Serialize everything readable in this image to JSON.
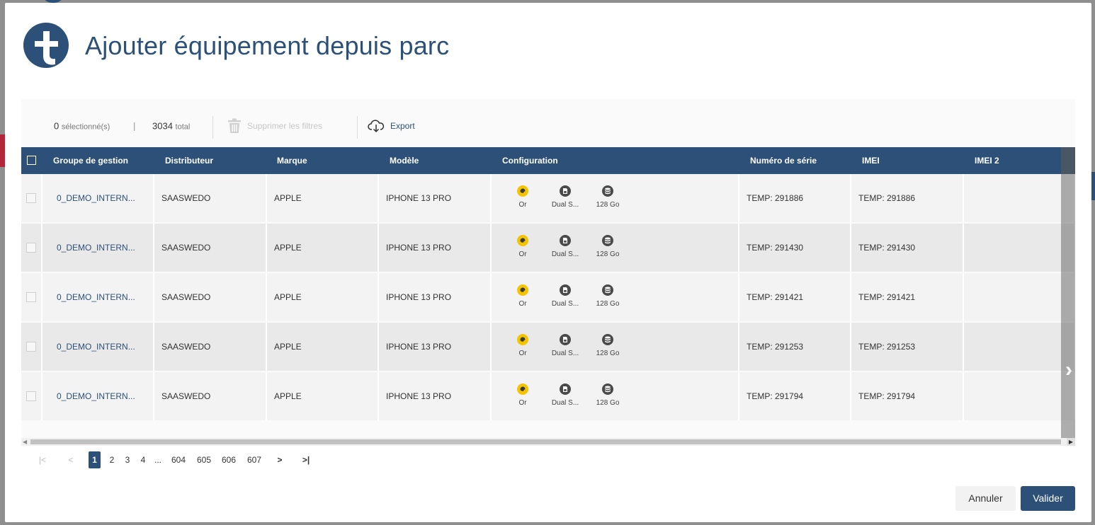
{
  "dialog": {
    "title": "Ajouter équipement depuis parc"
  },
  "toolbar": {
    "selected_count": "0",
    "selected_label": "sélectionné(s)",
    "separator": "|",
    "total_count": "3034",
    "total_label": "total",
    "clear_filters_label": "Supprimer les filtres",
    "export_label": "Export"
  },
  "table": {
    "headers": {
      "group": "Groupe de gestion",
      "distributor": "Distributeur",
      "brand": "Marque",
      "model": "Modèle",
      "configuration": "Configuration",
      "serial": "Numéro de série",
      "imei": "IMEI",
      "imei2": "IMEI 2"
    },
    "rows": [
      {
        "group": "0_DEMO_INTERN...",
        "distributor": "SAASWEDO",
        "brand": "APPLE",
        "model": "IPHONE 13 PRO",
        "color": "Or",
        "sim": "Dual S...",
        "storage": "128 Go",
        "serial": "TEMP: 291886",
        "imei": "TEMP: 291886",
        "imei2": ""
      },
      {
        "group": "0_DEMO_INTERN...",
        "distributor": "SAASWEDO",
        "brand": "APPLE",
        "model": "IPHONE 13 PRO",
        "color": "Or",
        "sim": "Dual S...",
        "storage": "128 Go",
        "serial": "TEMP: 291430",
        "imei": "TEMP: 291430",
        "imei2": ""
      },
      {
        "group": "0_DEMO_INTERN...",
        "distributor": "SAASWEDO",
        "brand": "APPLE",
        "model": "IPHONE 13 PRO",
        "color": "Or",
        "sim": "Dual S...",
        "storage": "128 Go",
        "serial": "TEMP: 291421",
        "imei": "TEMP: 291421",
        "imei2": ""
      },
      {
        "group": "0_DEMO_INTERN...",
        "distributor": "SAASWEDO",
        "brand": "APPLE",
        "model": "IPHONE 13 PRO",
        "color": "Or",
        "sim": "Dual S...",
        "storage": "128 Go",
        "serial": "TEMP: 291253",
        "imei": "TEMP: 291253",
        "imei2": ""
      },
      {
        "group": "0_DEMO_INTERN...",
        "distributor": "SAASWEDO",
        "brand": "APPLE",
        "model": "IPHONE 13 PRO",
        "color": "Or",
        "sim": "Dual S...",
        "storage": "128 Go",
        "serial": "TEMP: 291794",
        "imei": "TEMP: 291794",
        "imei2": ""
      }
    ]
  },
  "pagination": {
    "first": "|<",
    "prev": "<",
    "pages": [
      "1",
      "2",
      "3",
      "4",
      "...",
      "604",
      "605",
      "606",
      "607"
    ],
    "active_page": "1",
    "next": ">",
    "last": ">|"
  },
  "footer": {
    "cancel_label": "Annuler",
    "confirm_label": "Valider"
  },
  "colors": {
    "primary": "#2c5077",
    "color_dot": "#f5c400",
    "icon_dark": "#4a4a4a"
  },
  "icons": {
    "logo": "brand-logo-icon",
    "clear_filters": "trash-icon",
    "export": "cloud-download-icon",
    "config_color": "palette-icon",
    "config_sim": "sim-card-icon",
    "config_storage": "database-icon",
    "scroll_next": "chevron-right-icon"
  }
}
